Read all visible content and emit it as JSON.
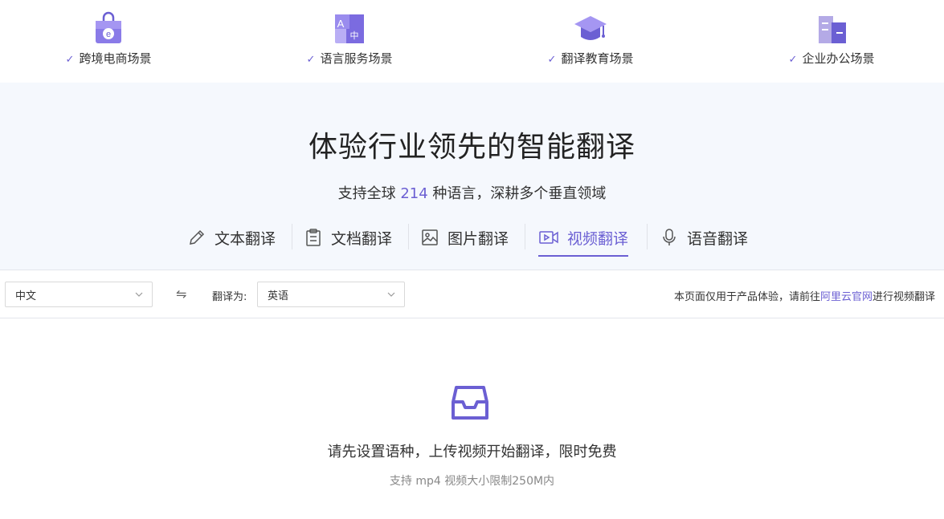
{
  "scenarios": [
    {
      "label": "跨境电商场景",
      "icon": "shopping-bag-icon"
    },
    {
      "label": "语言服务场景",
      "icon": "language-translate-icon"
    },
    {
      "label": "翻译教育场景",
      "icon": "graduation-cap-icon"
    },
    {
      "label": "企业办公场景",
      "icon": "office-building-icon"
    }
  ],
  "check_icon": "✓",
  "hero": {
    "title": "体验行业领先的智能翻译",
    "subtitle_pre": "支持全球 ",
    "subtitle_num": "214",
    "subtitle_post": " 种语言，深耕多个垂直领域"
  },
  "tabs": [
    {
      "label": "文本翻译",
      "icon": "pencil-icon",
      "active": false
    },
    {
      "label": "文档翻译",
      "icon": "clipboard-icon",
      "active": false
    },
    {
      "label": "图片翻译",
      "icon": "image-icon",
      "active": false
    },
    {
      "label": "视频翻译",
      "icon": "video-icon",
      "active": true
    },
    {
      "label": "语音翻译",
      "icon": "microphone-icon",
      "active": false
    }
  ],
  "toolbar": {
    "source_lang": "中文",
    "swap_symbol": "⇋",
    "target_label": "翻译为:",
    "target_lang": "英语",
    "notice_pre": "本页面仅用于产品体验，请前往",
    "notice_link": "阿里云官网",
    "notice_post": "进行视频翻译"
  },
  "empty_state": {
    "icon": "inbox-icon",
    "message": "请先设置语种，上传视频开始翻译，限时免费",
    "hint": "支持 mp4 视频大小限制250M内"
  },
  "colors": {
    "accent": "#6b5fd3",
    "hero_bg": "#f5f8fd"
  }
}
